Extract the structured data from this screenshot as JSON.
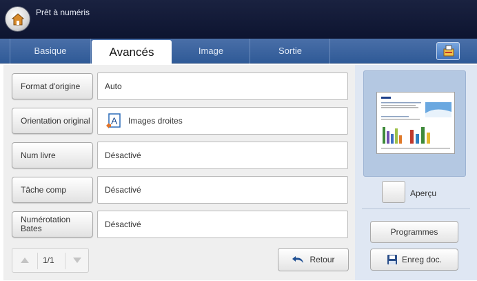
{
  "header": {
    "title": "Prêt à numéris",
    "home_icon": "home-icon"
  },
  "tabs": [
    {
      "label": "Basique",
      "active": false
    },
    {
      "label": "Avancés",
      "active": true
    },
    {
      "label": "Image",
      "active": false
    },
    {
      "label": "Sortie",
      "active": false
    }
  ],
  "tab_extra_icon": "job-status-icon",
  "options": [
    {
      "label": "Format d'origine",
      "value": "Auto"
    },
    {
      "label": "Orientation original",
      "value": "Images droites",
      "value_icon": "orientation-icon"
    },
    {
      "label": "Num livre",
      "value": "Désactivé"
    },
    {
      "label": "Tâche comp",
      "value": "Désactivé"
    },
    {
      "label": "Numérotation Bates",
      "value": "Désactivé"
    }
  ],
  "pager": {
    "text": "1/1"
  },
  "retour": {
    "label": "Retour",
    "icon": "back-arrow-icon"
  },
  "preview": {
    "apercu_label": "Aperçu"
  },
  "actions": {
    "programmes_label": "Programmes",
    "save_label": "Enreg doc.",
    "save_icon": "floppy-disk-icon"
  },
  "colors": {
    "title_bg": "#131a36",
    "tab_bg": "#3b64a0",
    "active_tab": "#ffffff",
    "panel_bg": "#efefef",
    "right_bg": "#dfe7f3"
  }
}
